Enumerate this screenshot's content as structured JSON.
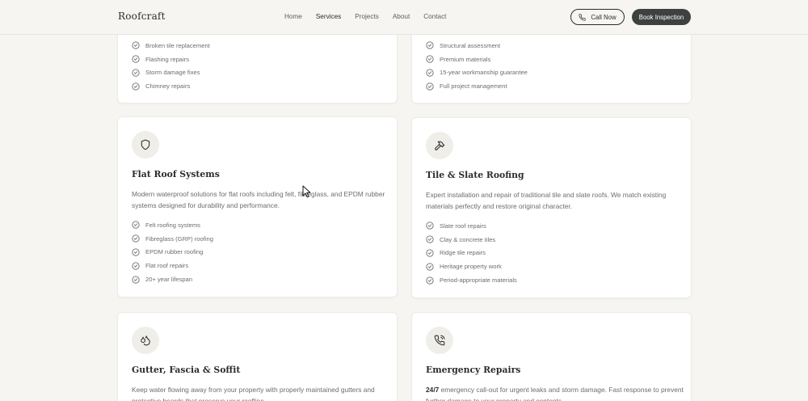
{
  "nav": {
    "logo": "Roofcraft",
    "links": [
      "Home",
      "Services",
      "Projects",
      "About",
      "Contact"
    ],
    "active_link": "Services",
    "call_label": "Call Now",
    "book_label": "Book Inspection"
  },
  "colors": {
    "background": "#f6f5f1",
    "card": "#ffffff",
    "primary_dark": "#3d4240",
    "muted_text": "#6b6e6c"
  },
  "cards": [
    {
      "id": "repairs",
      "features": [
        "Broken tile replacement",
        "Flashing repairs",
        "Storm damage fixes",
        "Chimney repairs"
      ]
    },
    {
      "id": "replacement",
      "features": [
        "Structural assessment",
        "Premium materials",
        "15-year workmanship guarantee",
        "Full project management"
      ]
    },
    {
      "id": "flat-roof",
      "icon": "shield-icon",
      "title": "Flat Roof Systems",
      "description": "Modern waterproof solutions for flat roofs including felt, fibreglass, and EPDM rubber systems designed for durability and performance.",
      "features": [
        "Felt roofing systems",
        "Fibreglass (GRP) roofing",
        "EPDM rubber roofing",
        "Flat roof repairs",
        "20+ year lifespan"
      ]
    },
    {
      "id": "tile-slate",
      "icon": "hammer-icon",
      "title": "Tile & Slate Roofing",
      "description": "Expert installation and repair of traditional tile and slate roofs. We match existing materials perfectly and restore original character.",
      "features": [
        "Slate roof repairs",
        "Clay & concrete tiles",
        "Ridge tile repairs",
        "Heritage property work",
        "Period-appropriate materials"
      ]
    },
    {
      "id": "gutter",
      "icon": "droplets-icon",
      "title": "Gutter, Fascia & Soffit",
      "description": "Keep water flowing away from your property with properly maintained gutters and protective boards that preserve your roofline."
    },
    {
      "id": "emergency",
      "icon": "phone-call-icon",
      "title": "Emergency Repairs",
      "description_strong": "24/7",
      "description": " emergency call-out for urgent leaks and storm damage. Fast response to prevent further damage to your property and contents."
    }
  ]
}
